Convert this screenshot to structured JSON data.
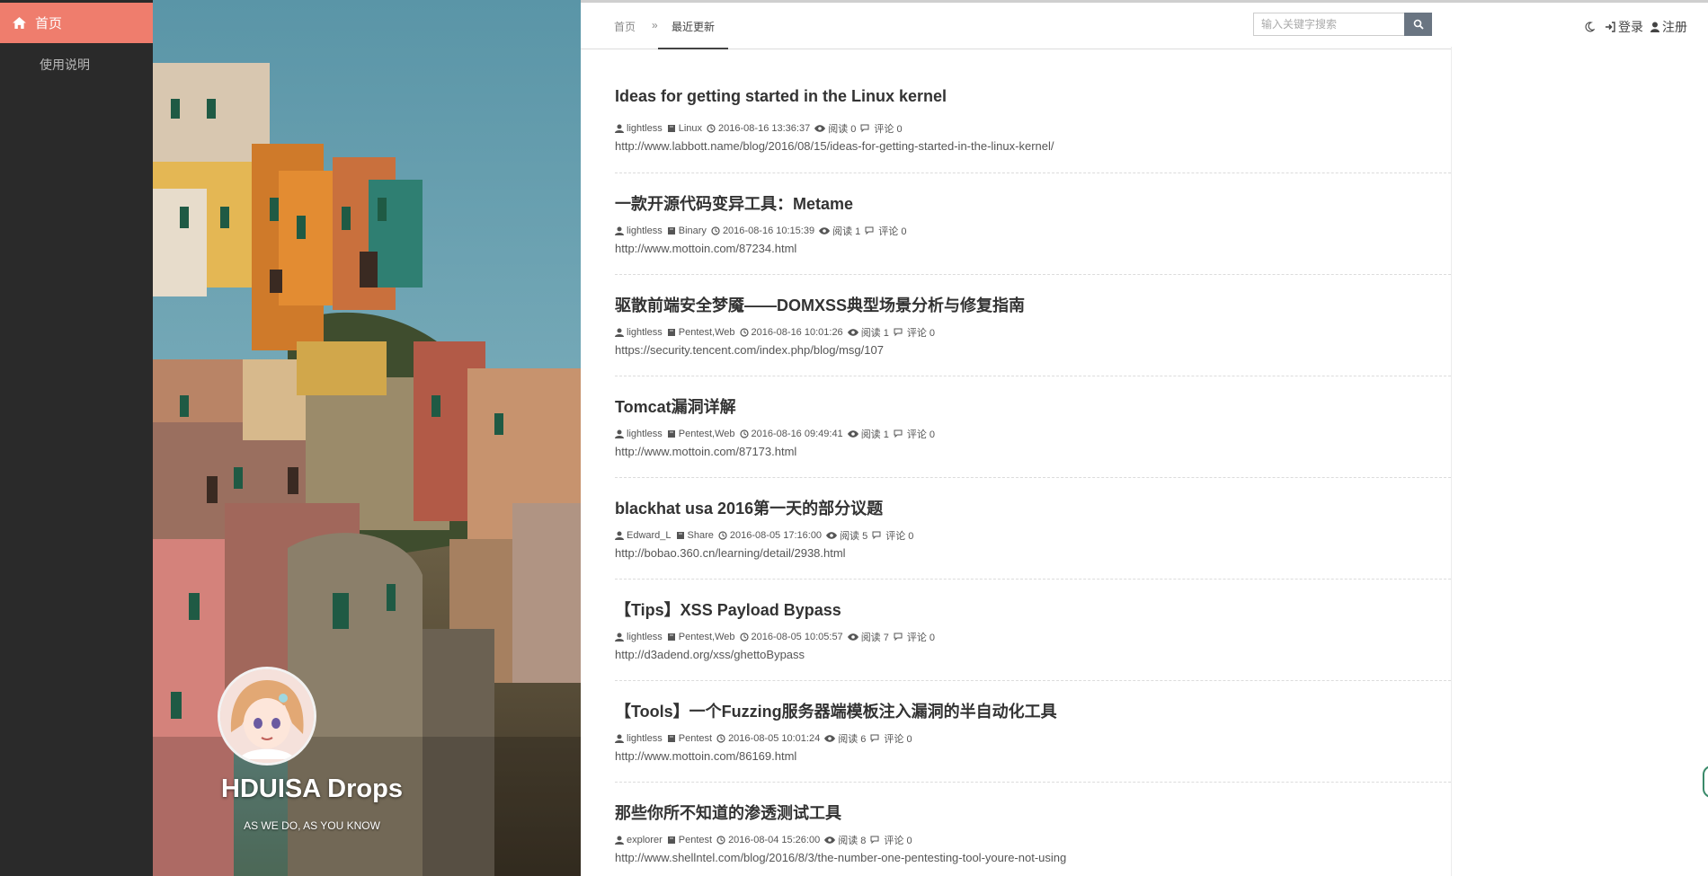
{
  "sidebar": {
    "active_label": "首页",
    "items": [
      {
        "label": "使用说明"
      }
    ]
  },
  "hero": {
    "title": "HDUISA Drops",
    "subtitle": "AS WE DO, AS YOU KNOW"
  },
  "breadcrumb": {
    "home": "首页",
    "separator": "»",
    "current": "最近更新"
  },
  "search": {
    "placeholder": "输入关键字搜索"
  },
  "user_links": {
    "login": "登录",
    "register": "注册"
  },
  "posts": [
    {
      "title": "Ideas for getting started in the Linux kernel",
      "author": "lightless",
      "category": "Linux",
      "time": "2016-08-16 13:36:37",
      "views": "阅读 0",
      "comments": "评论 0",
      "url": "http://www.labbott.name/blog/2016/08/15/ideas-for-getting-started-in-the-linux-kernel/"
    },
    {
      "title": "一款开源代码变异工具：Metame",
      "author": "lightless",
      "category": "Binary",
      "time": "2016-08-16 10:15:39",
      "views": "阅读 1",
      "comments": "评论 0",
      "url": "http://www.mottoin.com/87234.html"
    },
    {
      "title": "驱散前端安全梦魇——DOMXSS典型场景分析与修复指南",
      "author": "lightless",
      "category": "Pentest,Web",
      "time": "2016-08-16 10:01:26",
      "views": "阅读 1",
      "comments": "评论 0",
      "url": "https://security.tencent.com/index.php/blog/msg/107"
    },
    {
      "title": "Tomcat漏洞详解",
      "author": "lightless",
      "category": "Pentest,Web",
      "time": "2016-08-16 09:49:41",
      "views": "阅读 1",
      "comments": "评论 0",
      "url": "http://www.mottoin.com/87173.html"
    },
    {
      "title": "blackhat usa 2016第一天的部分议题",
      "author": "Edward_L",
      "category": "Share",
      "time": "2016-08-05 17:16:00",
      "views": "阅读 5",
      "comments": "评论 0",
      "url": "http://bobao.360.cn/learning/detail/2938.html"
    },
    {
      "title": "【Tips】XSS Payload Bypass",
      "author": "lightless",
      "category": "Pentest,Web",
      "time": "2016-08-05 10:05:57",
      "views": "阅读 7",
      "comments": "评论 0",
      "url": "http://d3adend.org/xss/ghettoBypass"
    },
    {
      "title": "【Tools】一个Fuzzing服务器端模板注入漏洞的半自动化工具",
      "author": "lightless",
      "category": "Pentest",
      "time": "2016-08-05 10:01:24",
      "views": "阅读 6",
      "comments": "评论 0",
      "url": "http://www.mottoin.com/86169.html"
    },
    {
      "title": "那些你所不知道的渗透测试工具",
      "author": "explorer",
      "category": "Pentest",
      "time": "2016-08-04 15:26:00",
      "views": "阅读 8",
      "comments": "评论 0",
      "url": "http://www.shellntel.com/blog/2016/8/3/the-number-one-pentesting-tool-youre-not-using"
    }
  ]
}
